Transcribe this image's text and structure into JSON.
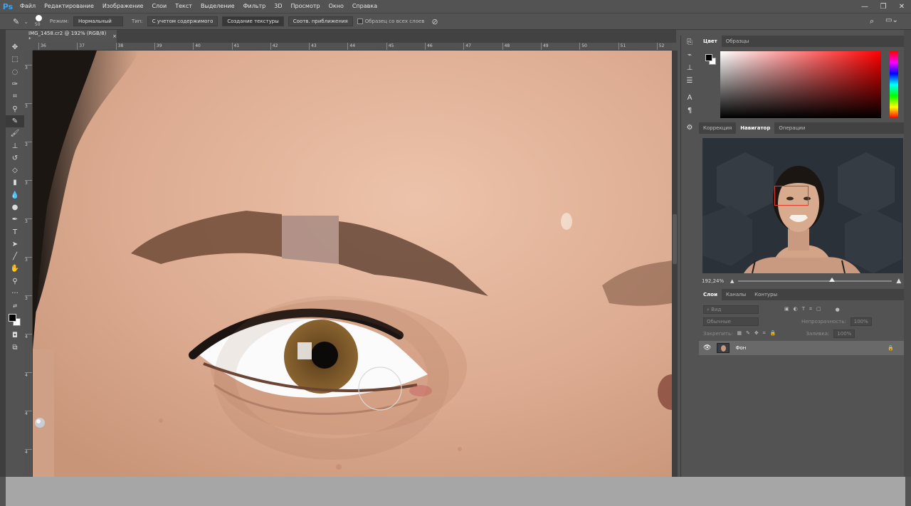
{
  "app": {
    "logo": "Ps"
  },
  "menu": [
    "Файл",
    "Редактирование",
    "Изображение",
    "Слои",
    "Текст",
    "Выделение",
    "Фильтр",
    "3D",
    "Просмотр",
    "Окно",
    "Справка"
  ],
  "window_controls": [
    "—",
    "❐",
    "✕"
  ],
  "options": {
    "tool_icon": "healing-brush-icon",
    "brush_size": "50",
    "mode_label": "Режим:",
    "mode_value": "Нормальный",
    "type_label": "Тип:",
    "btn_content_aware": "С учетом содержимого",
    "btn_create_texture": "Создание текстуры",
    "btn_proximity_match": "Соотв. приближения",
    "sample_all_layers": "Образец со всех слоев"
  },
  "document": {
    "tab_title": "IMG_1458.cr2 @ 192% (RGB/8) *",
    "close": "×",
    "ruler_top": [
      "36",
      "37",
      "38",
      "39",
      "40",
      "41",
      "42",
      "43",
      "44",
      "45",
      "46",
      "47",
      "48",
      "49",
      "50",
      "51",
      "52"
    ],
    "ruler_left": [
      "3",
      "3",
      "3",
      "3",
      "3",
      "3",
      "3",
      "4",
      "4",
      "4",
      "4"
    ]
  },
  "color_panel": {
    "tabs": [
      "Цвет",
      "Образцы"
    ],
    "active": "Цвет",
    "fg": "#000000",
    "bg": "#ffffff"
  },
  "navigator_panel": {
    "tabs": [
      "Коррекция",
      "Навигатор",
      "Операции"
    ],
    "active": "Навигатор",
    "zoom": "192,24%"
  },
  "layers_panel": {
    "tabs": [
      "Слои",
      "Каналы",
      "Контуры"
    ],
    "active": "Слои",
    "search_placeholder": "Вид",
    "blend_mode": "Обычные",
    "opacity_label": "Непрозрачность:",
    "opacity_value": "100%",
    "lock_label": "Закрепить:",
    "fill_label": "Заливка:",
    "fill_value": "100%",
    "layer_name": "Фон"
  },
  "colors": {
    "ps_blue": "#31a8ff",
    "nav_frame": "#e23b2e",
    "skin": "#dcae93"
  }
}
